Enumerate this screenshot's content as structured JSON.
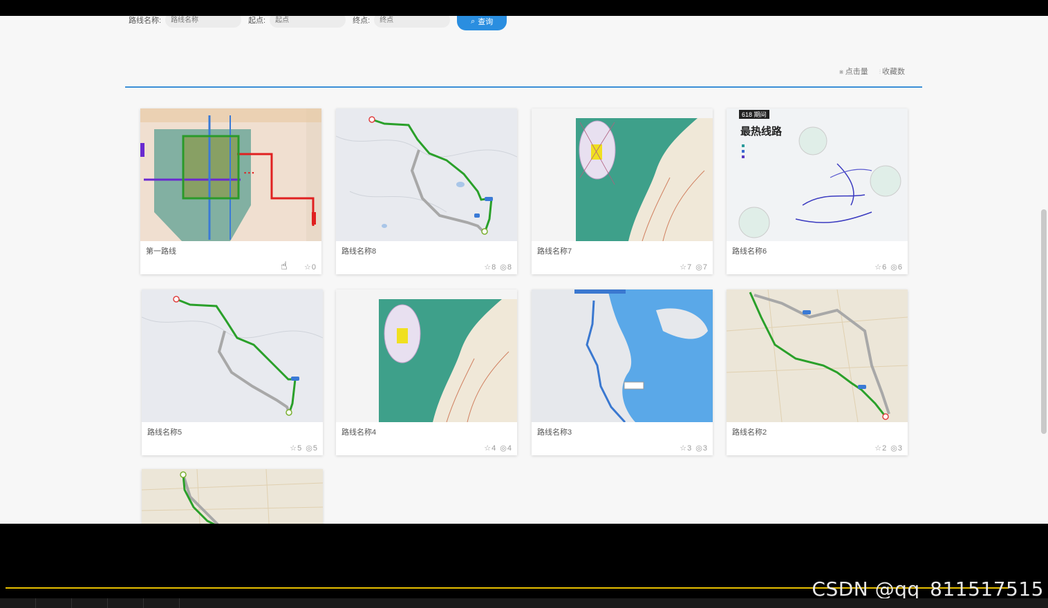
{
  "search": {
    "route_name_label": "路线名称:",
    "route_name_placeholder": "路线名称",
    "start_label": "起点:",
    "start_placeholder": "起点",
    "end_label": "终点:",
    "end_placeholder": "终点",
    "button_label": "查询"
  },
  "sort": {
    "clicks_label": "点击量",
    "favorites_label": "收藏数"
  },
  "cards": [
    {
      "title": "第一路线",
      "favorites": "0",
      "views": ""
    },
    {
      "title": "路线名称8",
      "favorites": "8",
      "views": "8"
    },
    {
      "title": "路线名称7",
      "favorites": "7",
      "views": "7"
    },
    {
      "title": "路线名称6",
      "favorites": "6",
      "views": "6"
    },
    {
      "title": "路线名称5",
      "favorites": "5",
      "views": "5"
    },
    {
      "title": "路线名称4",
      "favorites": "4",
      "views": "4"
    },
    {
      "title": "路线名称3",
      "favorites": "3",
      "views": "3"
    },
    {
      "title": "路线名称2",
      "favorites": "2",
      "views": "3"
    }
  ],
  "thumb_text": {
    "hot_badge": "618 期间",
    "hot_title": "最热线路"
  },
  "watermark": "CSDN @qq_811517515"
}
